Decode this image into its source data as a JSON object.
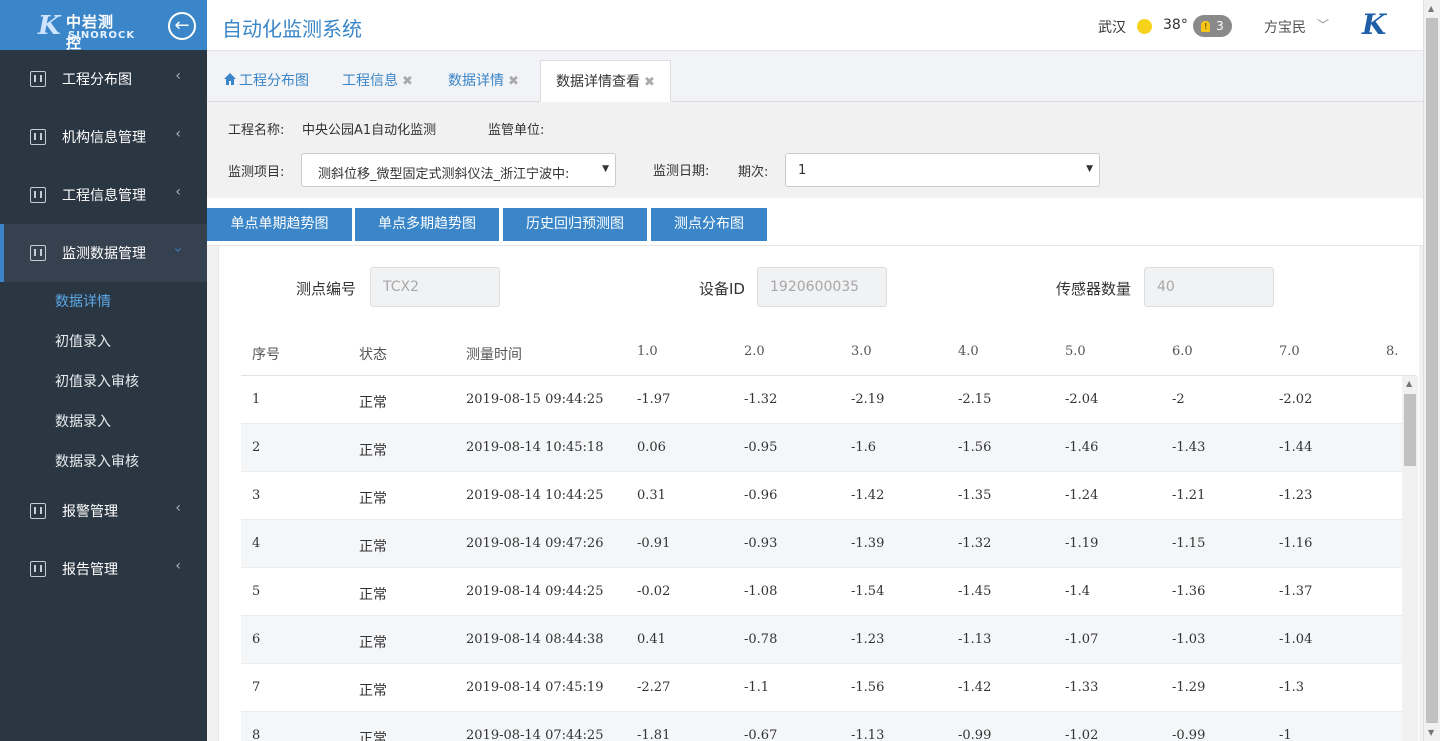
{
  "brand": {
    "logo_cn": "中岩测控",
    "logo_en": "SINOROCK",
    "logo_mark": "K"
  },
  "header": {
    "title": "自动化监测系统",
    "city": "武汉",
    "temperature": "38°",
    "alert_count": "3",
    "user": "方宝民"
  },
  "sidebar": {
    "items": [
      {
        "label": "工程分布图"
      },
      {
        "label": "机构信息管理"
      },
      {
        "label": "工程信息管理"
      },
      {
        "label": "监测数据管理"
      },
      {
        "label": "报警管理"
      },
      {
        "label": "报告管理"
      }
    ],
    "submenu": [
      "数据详情",
      "初值录入",
      "初值录入审核",
      "数据录入",
      "数据录入审核"
    ]
  },
  "tabs": [
    {
      "label": "工程分布图"
    },
    {
      "label": "工程信息"
    },
    {
      "label": "数据详情"
    },
    {
      "label": "数据详情查看"
    }
  ],
  "filters": {
    "project_name_label": "工程名称:",
    "project_name_value": "中央公园A1自动化监测",
    "supervisor_label": "监管单位:",
    "item_label": "监测项目:",
    "item_value": "测斜位移_微型固定式测斜仪法_浙江宁波中:",
    "date_label": "监测日期:",
    "period_label": "期次:",
    "period_value": "1"
  },
  "actions": [
    "单点单期趋势图",
    "单点多期趋势图",
    "历史回归预测图",
    "测点分布图"
  ],
  "info": {
    "point_label": "测点编号",
    "point_value": "TCX2",
    "device_label": "设备ID",
    "device_value": "1920600035",
    "sensor_label": "传感器数量",
    "sensor_value": "40"
  },
  "table": {
    "headers": [
      "序号",
      "状态",
      "测量时间",
      "1.0",
      "2.0",
      "3.0",
      "4.0",
      "5.0",
      "6.0",
      "7.0",
      "8."
    ],
    "rows": [
      [
        "1",
        "正常",
        "2019-08-15 09:44:25",
        "-1.97",
        "-1.32",
        "-2.19",
        "-2.15",
        "-2.04",
        "-2",
        "-2.02"
      ],
      [
        "2",
        "正常",
        "2019-08-14 10:45:18",
        "0.06",
        "-0.95",
        "-1.6",
        "-1.56",
        "-1.46",
        "-1.43",
        "-1.44"
      ],
      [
        "3",
        "正常",
        "2019-08-14 10:44:25",
        "0.31",
        "-0.96",
        "-1.42",
        "-1.35",
        "-1.24",
        "-1.21",
        "-1.23"
      ],
      [
        "4",
        "正常",
        "2019-08-14 09:47:26",
        "-0.91",
        "-0.93",
        "-1.39",
        "-1.32",
        "-1.19",
        "-1.15",
        "-1.16"
      ],
      [
        "5",
        "正常",
        "2019-08-14 09:44:25",
        "-0.02",
        "-1.08",
        "-1.54",
        "-1.45",
        "-1.4",
        "-1.36",
        "-1.37"
      ],
      [
        "6",
        "正常",
        "2019-08-14 08:44:38",
        "0.41",
        "-0.78",
        "-1.23",
        "-1.13",
        "-1.07",
        "-1.03",
        "-1.04"
      ],
      [
        "7",
        "正常",
        "2019-08-14 07:45:19",
        "-2.27",
        "-1.1",
        "-1.56",
        "-1.42",
        "-1.33",
        "-1.29",
        "-1.3"
      ],
      [
        "8",
        "正常",
        "2019-08-14 07:44:25",
        "-1.81",
        "-0.67",
        "-1.13",
        "-0.99",
        "-1.02",
        "-0.99",
        "-1"
      ]
    ]
  },
  "colors": {
    "accent": "#3a86c8",
    "sidebar": "#2b3643"
  }
}
